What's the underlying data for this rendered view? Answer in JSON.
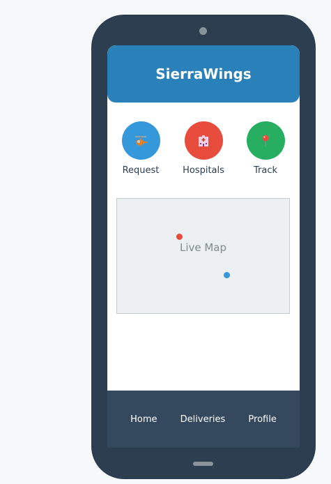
{
  "app": {
    "title": "SierraWings"
  },
  "actions": [
    {
      "label": "Request",
      "icon": "helicopter-icon",
      "color": "#3498db"
    },
    {
      "label": "Hospitals",
      "icon": "hospital-icon",
      "color": "#e74c3c"
    },
    {
      "label": "Track",
      "icon": "pushpin-icon",
      "color": "#27ae60"
    }
  ],
  "map": {
    "label": "Live Map",
    "markers": [
      {
        "name": "red-marker",
        "color": "#e74c3c"
      },
      {
        "name": "blue-marker",
        "color": "#3498db"
      }
    ]
  },
  "nav": {
    "home": "Home",
    "deliveries": "Deliveries",
    "profile": "Profile"
  },
  "colors": {
    "header": "#2a80b9",
    "device": "#2c3e50",
    "nav": "#34495e",
    "map_bg": "#ecf0f1"
  }
}
